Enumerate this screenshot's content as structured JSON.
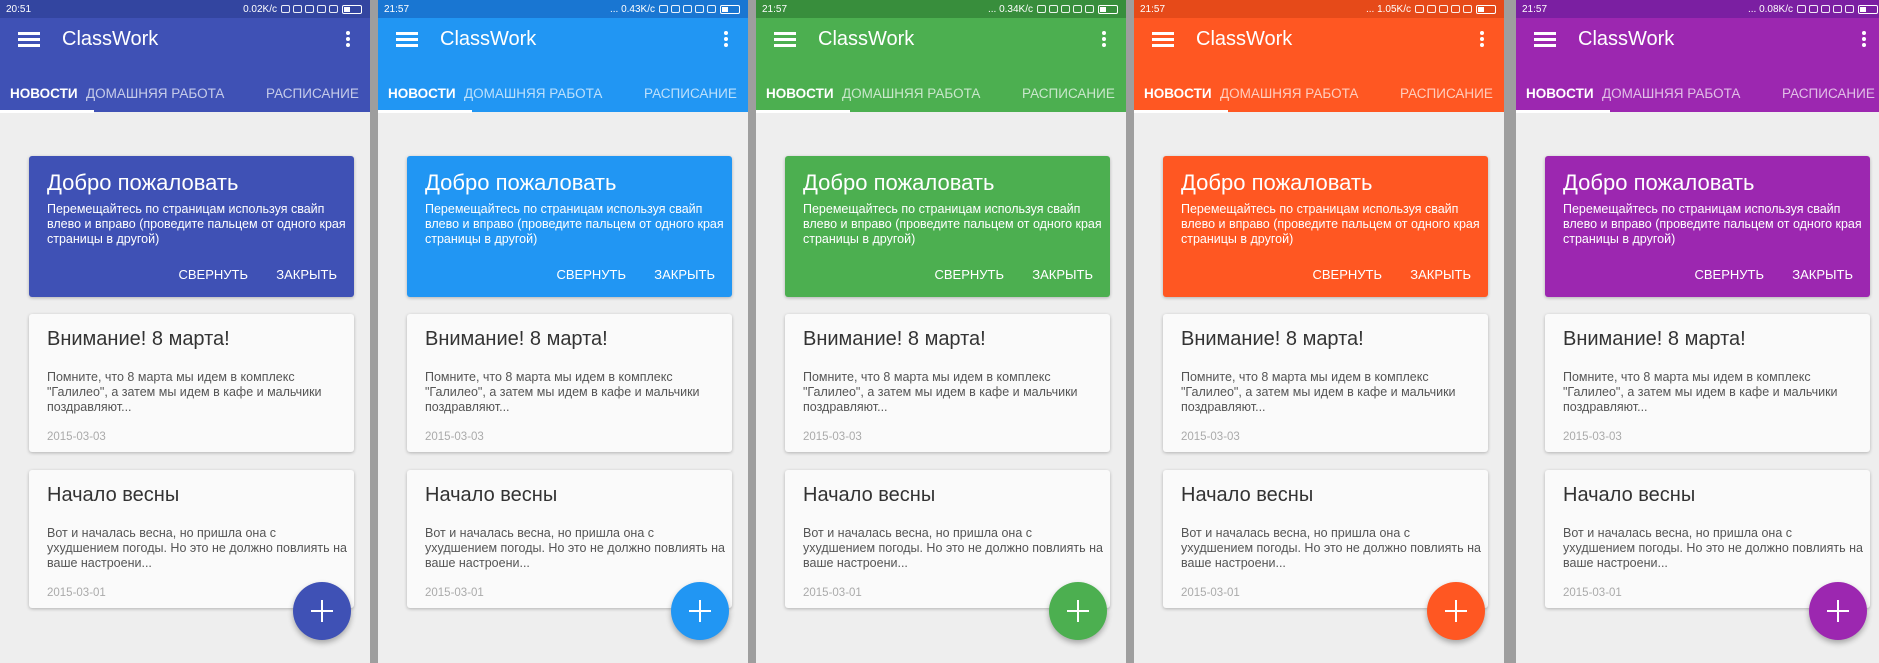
{
  "app": {
    "title": "ClassWork",
    "tabs": [
      "НОВОСТИ",
      "ДОМАШНЯЯ РАБОТА",
      "РАСПИСАНИЕ"
    ],
    "welcome": {
      "title": "Добро пожаловать",
      "text": "Перемещайтесь по страницам используя свайп влево и вправо (проведите пальцем от одного края страницы в другой)",
      "collapse": "СВЕРНУТЬ",
      "close": "ЗАКРЫТЬ"
    },
    "news": [
      {
        "title": "Внимание! 8 марта!",
        "text": "Помните, что 8 марта мы идем в комплекс \"Галилео\", а затем мы идем в кафе и мальчики поздравляют...",
        "date": "2015-03-03"
      },
      {
        "title": "Начало весны",
        "text": "Вот и началась весна, но пришла она с ухудшением погоды. Но это не должно повлиять на ваше настроени...",
        "date": "2015-03-01"
      }
    ],
    "icons": {
      "menu": "hamburger-menu-icon",
      "overflow": "more-vert-icon",
      "fab": "add-icon"
    }
  },
  "themes": [
    {
      "status_time": "20:51",
      "status_speed": "0.02K/c",
      "status_bar_color": "#3345a0",
      "color": "#3f51b5",
      "fab_color": "#3f51b5"
    },
    {
      "status_time": "21:57",
      "status_speed": "... 0.43K/c",
      "status_bar_color": "#1976d2",
      "color": "#2196f3",
      "fab_color": "#2196f3"
    },
    {
      "status_time": "21:57",
      "status_speed": "... 0.34K/c",
      "status_bar_color": "#388e3c",
      "color": "#4caf50",
      "fab_color": "#4caf50"
    },
    {
      "status_time": "21:57",
      "status_speed": "... 1.05K/c",
      "status_bar_color": "#e64a19",
      "color": "#ff5722",
      "fab_color": "#ff5722"
    },
    {
      "status_time": "21:57",
      "status_speed": "... 0.08K/c",
      "status_bar_color": "#7b1fa2",
      "color": "#9c27b0",
      "fab_color": "#9c27b0"
    }
  ]
}
